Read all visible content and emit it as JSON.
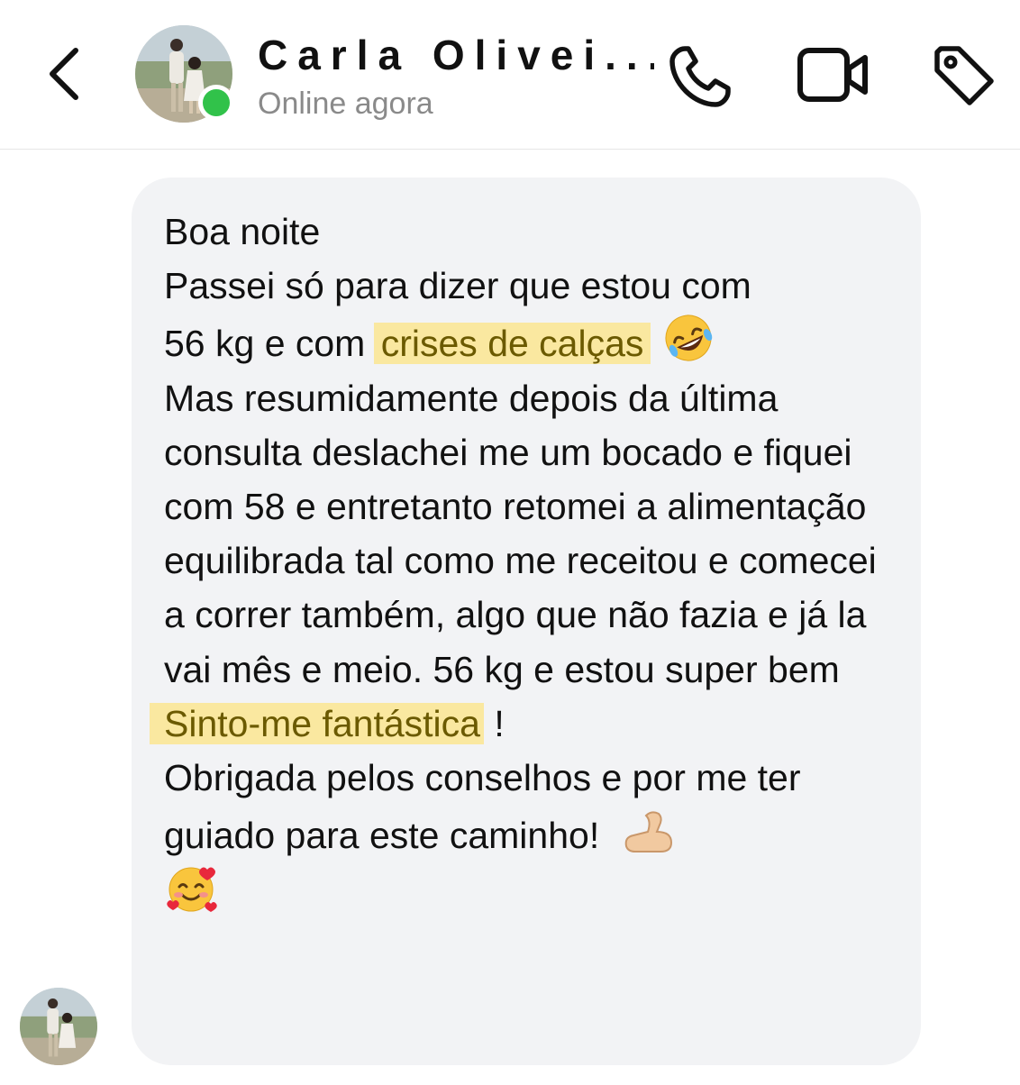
{
  "header": {
    "contact_name": "Carla Olivei...",
    "status": "Online agora",
    "back_icon": "chevron-left-icon",
    "call_icon": "phone-icon",
    "video_icon": "video-camera-icon",
    "tag_icon": "tag-icon",
    "online_color": "#31c24a"
  },
  "message": {
    "line1": "Boa noite",
    "line2a": "Passei só para dizer que estou com",
    "line2b": "56 kg e com ",
    "highlight1": "crises de calças",
    "emoji1": "rolling-on-floor-laughing-emoji",
    "paragraph2": "Mas resumidamente depois da última consulta deslachei me um bocado e fiquei com 58 e entretanto retomei a alimentação equilibrada tal como me receitou e comecei a correr também, algo que não fazia e já la vai mês e meio. 56 kg e estou super bem",
    "highlight2": "Sinto-me fantástica",
    "exclaim": " !",
    "paragraph3": "Obrigada pelos conselhos e por me ter guiado para este caminho!",
    "emoji2": "flexed-biceps-emoji",
    "emoji3": "smiling-face-with-hearts-emoji",
    "highlight_color": "#fae8a0"
  }
}
